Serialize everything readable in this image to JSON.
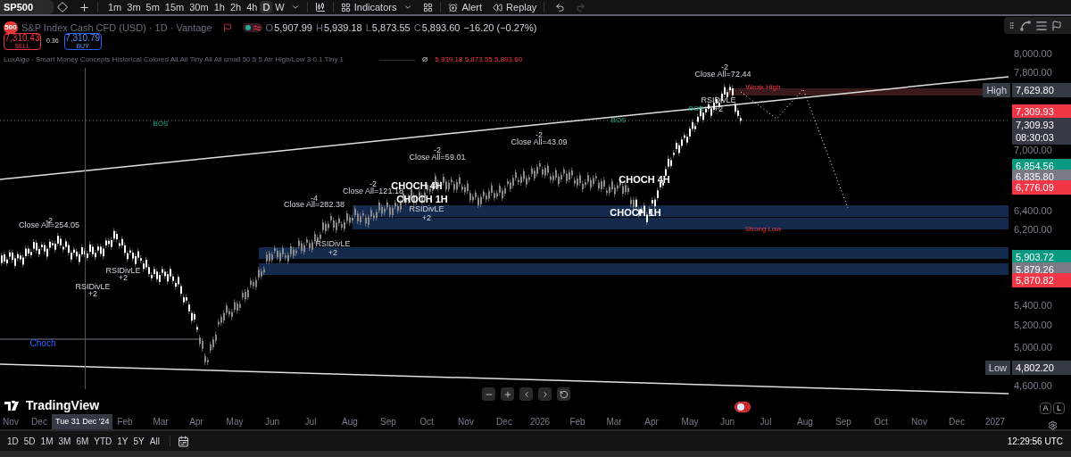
{
  "toolbar": {
    "symbol": "SP500",
    "intervals": [
      {
        "label": "1m",
        "selected": false
      },
      {
        "label": "3m",
        "selected": false
      },
      {
        "label": "5m",
        "selected": false
      },
      {
        "label": "15m",
        "selected": false
      },
      {
        "label": "30m",
        "selected": false
      },
      {
        "label": "1h",
        "selected": false
      },
      {
        "label": "2h",
        "selected": false
      },
      {
        "label": "4h",
        "selected": false
      },
      {
        "label": "D",
        "selected": true
      },
      {
        "label": "W",
        "selected": false
      }
    ],
    "indicators": "Indicators",
    "alert": "Alert",
    "replay": "Replay"
  },
  "legend": {
    "logo": "500",
    "title": "S&P Index Cash CFD (USD) · 1D · Vantage",
    "ohlc": [
      {
        "key": "O",
        "value": "5,907.99"
      },
      {
        "key": "H",
        "value": "5,939.18"
      },
      {
        "key": "L",
        "value": "5,873.55"
      },
      {
        "key": "C",
        "value": "5,893.60"
      }
    ],
    "change": "−16.20 (−0.27%)"
  },
  "trade": {
    "sell_price": "7,310.43",
    "sell": "SELL",
    "spread": "0.36",
    "buy_price": "7,310.79",
    "buy": "BUY"
  },
  "indicator": {
    "name": "LuxAlgo - Smart Money Concepts Historical Colored All All Tiny All All small 50 5 5 Atr High/Low 3 0.1 Tiny 1",
    "symbol": "Ø",
    "values": "5,939.18 5,873.55 5,893.60"
  },
  "chart_labels": [
    {
      "kind": "note",
      "text": "-2"
    },
    {
      "kind": "note",
      "text": "Close All=254.05"
    },
    {
      "kind": "note",
      "text": "RSIDivLE"
    },
    {
      "kind": "note",
      "text": "+2"
    },
    {
      "kind": "note",
      "text": "RSIDivLE"
    },
    {
      "kind": "note",
      "text": "+2"
    },
    {
      "kind": "note",
      "text": "-4"
    },
    {
      "kind": "note",
      "text": "Close All=282.38"
    },
    {
      "kind": "note",
      "text": "RSIDivLE"
    },
    {
      "kind": "note",
      "text": "+2"
    },
    {
      "kind": "note",
      "text": "-2"
    },
    {
      "kind": "note",
      "text": "Close All=121.18"
    },
    {
      "kind": "note",
      "text": "-2"
    },
    {
      "kind": "note",
      "text": "Close All=59.01"
    },
    {
      "kind": "structure",
      "text": "CHOCH 4H"
    },
    {
      "kind": "structure",
      "text": "CHOCH 1H"
    },
    {
      "kind": "note",
      "text": "RSIDivLE"
    },
    {
      "kind": "note",
      "text": "+2"
    },
    {
      "kind": "note",
      "text": "-2"
    },
    {
      "kind": "note",
      "text": "Close All=43.09"
    },
    {
      "kind": "structure",
      "text": "CHOCH 4H"
    },
    {
      "kind": "structure",
      "text": "CHOCH 1H"
    },
    {
      "kind": "note",
      "text": "-2"
    },
    {
      "kind": "note",
      "text": "Close All=72.44"
    },
    {
      "kind": "note",
      "text": "RSIDivLE"
    },
    {
      "kind": "note",
      "text": "+2"
    },
    {
      "kind": "bos",
      "text": "BOS"
    },
    {
      "kind": "bos",
      "text": "BOS"
    },
    {
      "kind": "bos",
      "text": "BOS"
    },
    {
      "kind": "level",
      "text": "Weak High"
    },
    {
      "kind": "level",
      "text": "Strong Low"
    },
    {
      "kind": "choch",
      "text": "Choch"
    }
  ],
  "price_axis": [
    {
      "kind": "tick",
      "text": "8,000.00"
    },
    {
      "kind": "tick",
      "text": "7,800.00"
    },
    {
      "kind": "badge",
      "caption": "High",
      "text": "7,629.80",
      "color": "#363a45"
    },
    {
      "kind": "badge",
      "text": "7,309.93",
      "color": "#f23645"
    },
    {
      "kind": "badge",
      "text": "7,309.93",
      "sub": "08:30:03",
      "color": "#363a45"
    },
    {
      "kind": "tick",
      "text": "7,000.00"
    },
    {
      "kind": "badge",
      "text": "6,854.56",
      "color": "#089981"
    },
    {
      "kind": "badge",
      "text": "6,835.80",
      "color": "#787b86"
    },
    {
      "kind": "badge",
      "text": "6,776.09",
      "color": "#f23645"
    },
    {
      "kind": "tick",
      "text": "6,400.00"
    },
    {
      "kind": "tick",
      "text": "6,200.00"
    },
    {
      "kind": "badge",
      "text": "5,903.72",
      "color": "#089981"
    },
    {
      "kind": "badge",
      "text": "5,879.26",
      "color": "#787b86"
    },
    {
      "kind": "badge",
      "text": "5,870.82",
      "color": "#f23645"
    },
    {
      "kind": "tick",
      "text": "5,400.00"
    },
    {
      "kind": "tick",
      "text": "5,200.00"
    },
    {
      "kind": "tick",
      "text": "5,000.00"
    },
    {
      "kind": "badge",
      "caption": "Low",
      "text": "4,802.20",
      "color": "#363a45"
    },
    {
      "kind": "tick",
      "text": "4,600.00"
    }
  ],
  "scale_buttons": [
    "A",
    "L"
  ],
  "time_axis": [
    "Nov",
    "Dec",
    "Feb",
    "Mar",
    "Apr",
    "May",
    "Jun",
    "Jul",
    "Aug",
    "Sep",
    "Oct",
    "Nov",
    "Dec",
    "2026",
    "Feb",
    "Mar",
    "Apr",
    "May",
    "Jun",
    "Jul",
    "Aug",
    "Sep",
    "Oct",
    "Nov",
    "Dec",
    "2027"
  ],
  "crosshair_date": "Tue 31 Dec '24",
  "brand": "TradingView",
  "ranges": [
    "1D",
    "5D",
    "1M",
    "3M",
    "6M",
    "YTD",
    "1Y",
    "5Y",
    "All"
  ],
  "clock": "12:29:56 UTC"
}
